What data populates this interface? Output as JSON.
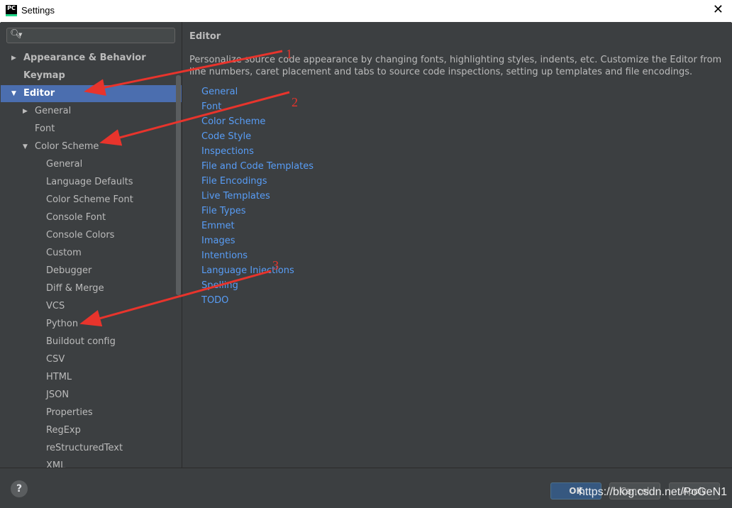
{
  "window": {
    "title": "Settings",
    "app_icon_text": "PC",
    "close_glyph": "✕"
  },
  "search": {
    "placeholder": "",
    "icon": "search-icon"
  },
  "tree": [
    {
      "id": "appearance",
      "label": "Appearance & Behavior",
      "bold": true,
      "arrow": "▶"
    },
    {
      "id": "keymap",
      "label": "Keymap",
      "bold": true,
      "arrow": ""
    },
    {
      "id": "editor",
      "label": "Editor",
      "bold": true,
      "arrow": "▼",
      "selected": true
    },
    {
      "id": "general",
      "label": "General",
      "arrow": "▶"
    },
    {
      "id": "font",
      "label": "Font",
      "arrow": ""
    },
    {
      "id": "color-scheme",
      "label": "Color Scheme",
      "arrow": "▼"
    },
    {
      "id": "cs-general",
      "label": "General"
    },
    {
      "id": "language-defaults",
      "label": "Language Defaults"
    },
    {
      "id": "color-scheme-font",
      "label": "Color Scheme Font"
    },
    {
      "id": "console-font",
      "label": "Console Font"
    },
    {
      "id": "console-colors",
      "label": "Console Colors"
    },
    {
      "id": "custom",
      "label": "Custom"
    },
    {
      "id": "debugger",
      "label": "Debugger"
    },
    {
      "id": "diff-merge",
      "label": "Diff & Merge"
    },
    {
      "id": "vcs",
      "label": "VCS"
    },
    {
      "id": "python",
      "label": "Python"
    },
    {
      "id": "buildout-config",
      "label": "Buildout config"
    },
    {
      "id": "csv",
      "label": "CSV"
    },
    {
      "id": "html",
      "label": "HTML"
    },
    {
      "id": "json",
      "label": "JSON"
    },
    {
      "id": "properties",
      "label": "Properties"
    },
    {
      "id": "regexp",
      "label": "RegExp"
    },
    {
      "id": "restructuredtext",
      "label": "reStructuredText"
    },
    {
      "id": "xml",
      "label": "XML"
    }
  ],
  "main": {
    "title": "Editor",
    "description": "Personalize source code appearance by changing fonts, highlighting styles, indents, etc. Customize the Editor from line numbers, caret placement and tabs to source code inspections, setting up templates and file encodings.",
    "links": [
      "General",
      "Font",
      "Color Scheme",
      "Code Style",
      "Inspections",
      "File and Code Templates",
      "File Encodings",
      "Live Templates",
      "File Types",
      "Emmet",
      "Images",
      "Intentions",
      "Language Injections",
      "Spelling",
      "TODO"
    ]
  },
  "footer": {
    "help": "?",
    "ok": "OK",
    "cancel": "Cancel",
    "apply": "Apply"
  },
  "annotations": {
    "one": "1",
    "two": "2",
    "three": "3",
    "arrow_color": "#e8342c"
  },
  "watermark": "https://blog.csdn.net/PoGeN1",
  "colors": {
    "selection": "#4b6eaf",
    "link": "#589df6",
    "background": "#3c3f41"
  }
}
